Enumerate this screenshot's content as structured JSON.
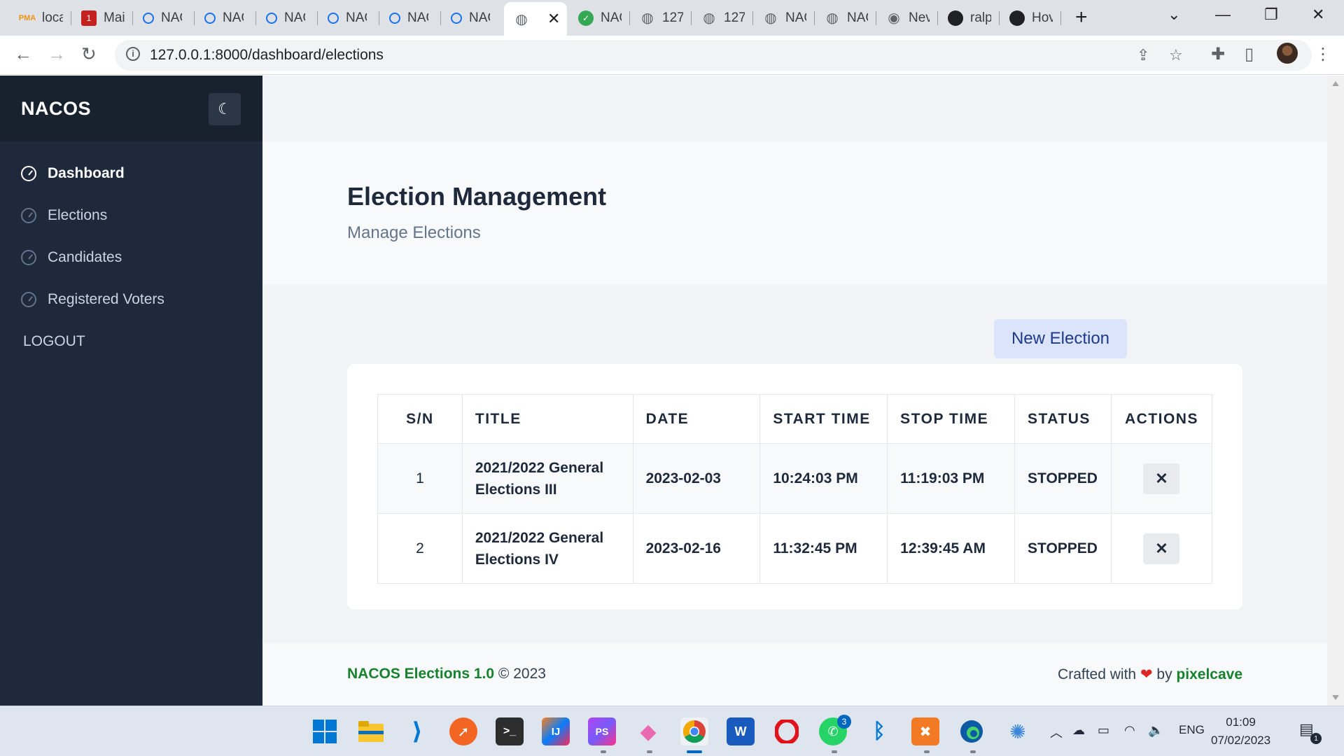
{
  "browser": {
    "tabs": [
      {
        "label": "loca",
        "icon": "phpmyadmin-icon"
      },
      {
        "label": "Mai",
        "icon": "mail-icon"
      },
      {
        "label": "NAC",
        "icon": "loading-icon"
      },
      {
        "label": "NAC",
        "icon": "loading-icon"
      },
      {
        "label": "NAC",
        "icon": "loading-icon"
      },
      {
        "label": "NAC",
        "icon": "loading-icon"
      },
      {
        "label": "NAC",
        "icon": "loading-icon"
      },
      {
        "label": "NAC",
        "icon": "loading-icon"
      },
      {
        "label": "",
        "icon": "globe-icon",
        "active": true
      },
      {
        "label": "NAC",
        "icon": "shield-icon"
      },
      {
        "label": "127",
        "icon": "globe-icon"
      },
      {
        "label": "127",
        "icon": "globe-icon"
      },
      {
        "label": "NAC",
        "icon": "globe-icon"
      },
      {
        "label": "NAC",
        "icon": "globe-icon"
      },
      {
        "label": "Nev",
        "icon": "chrome-icon"
      },
      {
        "label": "ralp",
        "icon": "github-icon"
      },
      {
        "label": "Hov",
        "icon": "github-icon"
      }
    ],
    "url": "127.0.0.1:8000/dashboard/elections"
  },
  "sidebar": {
    "brand": "NACOS",
    "nav": [
      {
        "label": "Dashboard",
        "active": true
      },
      {
        "label": "Elections",
        "active": false
      },
      {
        "label": "Candidates",
        "active": false
      },
      {
        "label": "Registered Voters",
        "active": false
      }
    ],
    "logout": "LOGOUT"
  },
  "hero": {
    "title": "Election Management",
    "subtitle": "Manage Elections"
  },
  "actions": {
    "new_election": "New Election"
  },
  "table": {
    "headers": [
      "S/N",
      "TITLE",
      "DATE",
      "START TIME",
      "STOP TIME",
      "STATUS",
      "ACTIONS"
    ],
    "rows": [
      {
        "sn": "1",
        "title": "2021/2022 General Elections III",
        "date": "2023-02-03",
        "start": "10:24:03 PM",
        "stop": "11:19:03 PM",
        "status": "STOPPED",
        "action": "✕"
      },
      {
        "sn": "2",
        "title": "2021/2022 General Elections IV",
        "date": "2023-02-16",
        "start": "11:32:45 PM",
        "stop": "12:39:45 AM",
        "status": "STOPPED",
        "action": "✕"
      }
    ]
  },
  "footer": {
    "app": "NACOS Elections 1.0",
    "copyright": "© 2023",
    "crafted": "Crafted with",
    "heart": "❤",
    "by": "by",
    "author": "pixelcave"
  },
  "taskbar": {
    "lang": "ENG",
    "time": "01:09",
    "date": "07/02/2023",
    "whatsapp_badge": "3",
    "notifications_badge": "1"
  },
  "colors": {
    "sidebar": "#1e293b",
    "accent_green": "#16822d",
    "button_bg": "#dbe4fb"
  }
}
